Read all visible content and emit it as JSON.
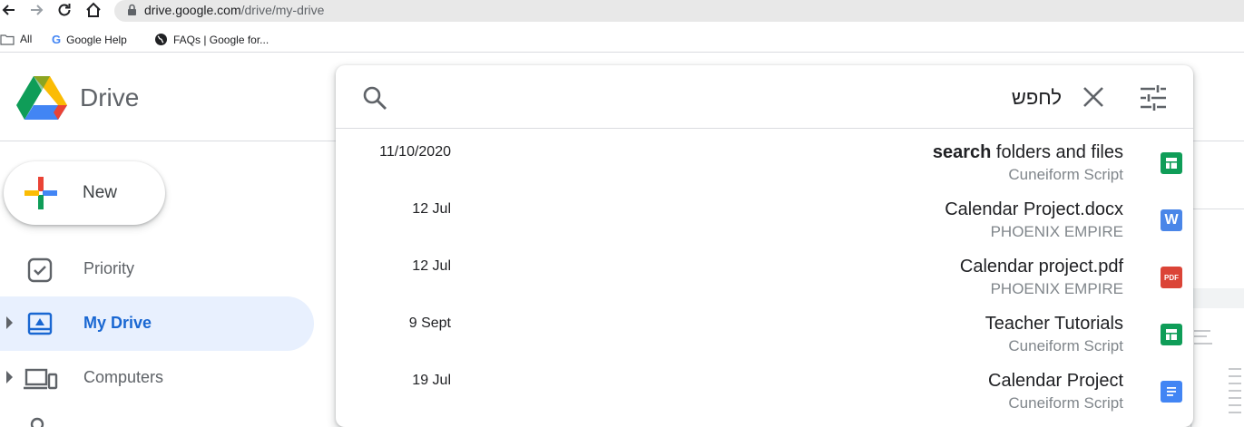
{
  "browser": {
    "url_host": "drive.google.com",
    "url_path": "/drive/my-drive",
    "bookmarks": [
      "All",
      "Google Help",
      "FAQs | Google for..."
    ]
  },
  "app": {
    "name": "Drive",
    "new_button": "New"
  },
  "sidebar": {
    "items": [
      {
        "label": "Priority",
        "icon": "priority-icon"
      },
      {
        "label": "My Drive",
        "icon": "my-drive-icon",
        "active": true
      },
      {
        "label": "Computers",
        "icon": "computers-icon"
      }
    ]
  },
  "search": {
    "query": "לחפש",
    "results": [
      {
        "date": "11/10/2020",
        "title_bold": "search",
        "title_rest": " folders and files",
        "location": "Cuneiform Script",
        "type": "sheets",
        "color": "#0f9d58"
      },
      {
        "date": "12 Jul",
        "title_bold": "",
        "title_rest": "Calendar Project.docx",
        "location": "PHOENIX EMPIRE",
        "type": "word",
        "color": "#4a86e8"
      },
      {
        "date": "12 Jul",
        "title_bold": "",
        "title_rest": "Calendar project.pdf",
        "location": "PHOENIX EMPIRE",
        "type": "pdf",
        "color": "#db4437"
      },
      {
        "date": "9 Sept",
        "title_bold": "",
        "title_rest": "Teacher Tutorials",
        "location": "Cuneiform Script",
        "type": "sheets",
        "color": "#0f9d58"
      },
      {
        "date": "19 Jul",
        "title_bold": "",
        "title_rest": "Calendar Project",
        "location": "Cuneiform Script",
        "type": "docs",
        "color": "#4285f4"
      }
    ]
  },
  "colors": {
    "accent": "#1967d2",
    "active_bg": "#e8f0fe"
  }
}
